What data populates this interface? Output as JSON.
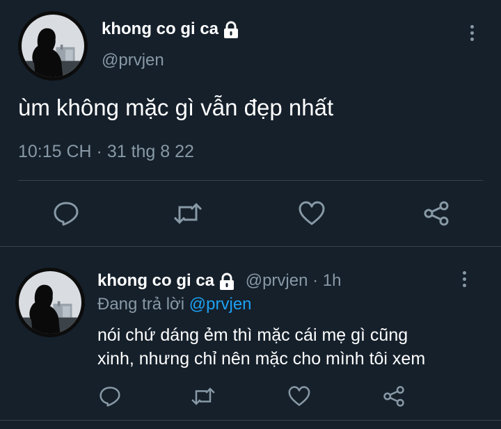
{
  "main_tweet": {
    "author_name": "khong co gi ca",
    "handle": "@prvjen",
    "text": "ùm không mặc gì vẫn đẹp nhất",
    "timestamp": "10:15 CH · 31 thg 8 22",
    "lock_icon": "lock-icon",
    "menu_icon": "more-vertical-icon"
  },
  "reply_tweet": {
    "author_name": "khong co gi ca",
    "handle": "@prvjen",
    "separator": "·",
    "age": "1h",
    "replying_prefix": "Đang trả lời",
    "replying_to": "@prvjen",
    "text_line1": "nói chứ dáng ẻm thì mặc cái mẹ gì cũng",
    "text_line2": "xinh, nhưng chỉ nên mặc cho mình tôi xem"
  },
  "actions": [
    "reply-icon",
    "retweet-icon",
    "like-icon",
    "share-icon"
  ],
  "colors": {
    "background": "#15202b",
    "text": "#ffffff",
    "secondary": "#8899a6",
    "link": "#1da1f2",
    "divider": "#38444d"
  }
}
